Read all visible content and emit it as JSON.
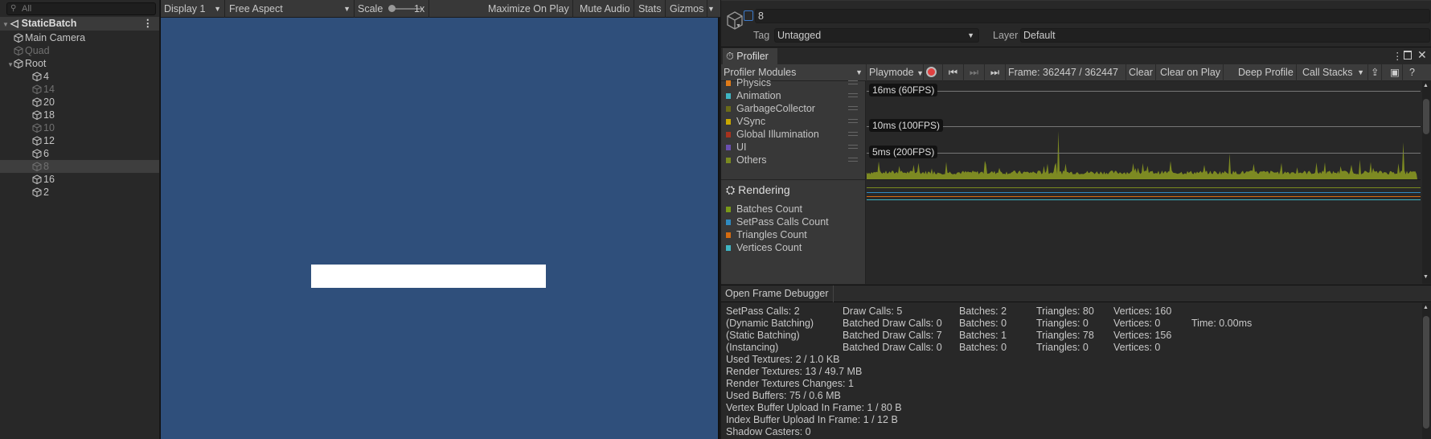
{
  "hierarchy": {
    "search_placeholder": "All",
    "scene": "StaticBatch",
    "items": [
      {
        "label": "Main Camera",
        "depth": 1,
        "active": true
      },
      {
        "label": "Quad",
        "depth": 1,
        "active": false
      },
      {
        "label": "Root",
        "depth": 1,
        "active": true,
        "expanded": true
      },
      {
        "label": "4",
        "depth": 2,
        "active": true
      },
      {
        "label": "14",
        "depth": 2,
        "active": false
      },
      {
        "label": "20",
        "depth": 2,
        "active": true
      },
      {
        "label": "18",
        "depth": 2,
        "active": true
      },
      {
        "label": "10",
        "depth": 2,
        "active": false
      },
      {
        "label": "12",
        "depth": 2,
        "active": true
      },
      {
        "label": "6",
        "depth": 2,
        "active": true
      },
      {
        "label": "8",
        "depth": 2,
        "active": false,
        "selected": true
      },
      {
        "label": "16",
        "depth": 2,
        "active": true
      },
      {
        "label": "2",
        "depth": 2,
        "active": true
      }
    ]
  },
  "game": {
    "display": "Display 1",
    "aspect": "Free Aspect",
    "scale_label": "Scale",
    "scale_value": "1x",
    "maximize": "Maximize On Play",
    "mute": "Mute Audio",
    "stats": "Stats",
    "gizmos": "Gizmos",
    "background": "#2f4f7b"
  },
  "inspector": {
    "name": "8",
    "tag_label": "Tag",
    "tag": "Untagged",
    "layer_label": "Layer",
    "layer": "Default"
  },
  "profiler": {
    "tab": "Profiler",
    "modules_label": "Profiler Modules",
    "playmode": "Playmode",
    "frame": "Frame: 362447 / 362447",
    "clear": "Clear",
    "clear_on_play": "Clear on Play",
    "deep_profile": "Deep Profile",
    "call_stacks": "Call Stacks",
    "cpu_modules": [
      {
        "label": "Physics",
        "color": "#e07b18"
      },
      {
        "label": "Animation",
        "color": "#3fb6c4"
      },
      {
        "label": "GarbageCollector",
        "color": "#6b6b18"
      },
      {
        "label": "VSync",
        "color": "#c9a800"
      },
      {
        "label": "Global Illumination",
        "color": "#a8321e"
      },
      {
        "label": "UI",
        "color": "#6a4fb0"
      },
      {
        "label": "Others",
        "color": "#7a8a20"
      }
    ],
    "cpu_lines": [
      "16ms (60FPS)",
      "10ms (100FPS)",
      "5ms (200FPS)"
    ],
    "rendering_title": "Rendering",
    "rendering_modules": [
      {
        "label": "Batches Count",
        "color": "#7a9a18"
      },
      {
        "label": "SetPass Calls Count",
        "color": "#2f8ac0"
      },
      {
        "label": "Triangles Count",
        "color": "#d46b10"
      },
      {
        "label": "Vertices Count",
        "color": "#3fb6c4"
      }
    ],
    "open_frame_debugger": "Open Frame Debugger",
    "stats_table": [
      [
        "SetPass Calls: 2",
        "Draw Calls: 5",
        "Batches: 2",
        "Triangles: 80",
        "Vertices: 160",
        ""
      ],
      [
        "(Dynamic Batching)",
        "Batched Draw Calls: 0",
        "Batches: 0",
        "Triangles: 0",
        "Vertices: 0",
        "Time: 0.00ms"
      ],
      [
        "(Static Batching)",
        "Batched Draw Calls: 7",
        "Batches: 1",
        "Triangles: 78",
        "Vertices: 156",
        ""
      ],
      [
        "(Instancing)",
        "Batched Draw Calls: 0",
        "Batches: 0",
        "Triangles: 0",
        "Vertices: 0",
        ""
      ]
    ],
    "stats_lines": [
      "Used Textures: 2 / 1.0 KB",
      "Render Textures: 13 / 49.7 MB",
      "Render Textures Changes: 1",
      "Used Buffers: 75 / 0.6 MB",
      "Vertex Buffer Upload In Frame: 1 / 80 B",
      "Index Buffer Upload In Frame: 1 / 12 B",
      "Shadow Casters: 0"
    ]
  }
}
